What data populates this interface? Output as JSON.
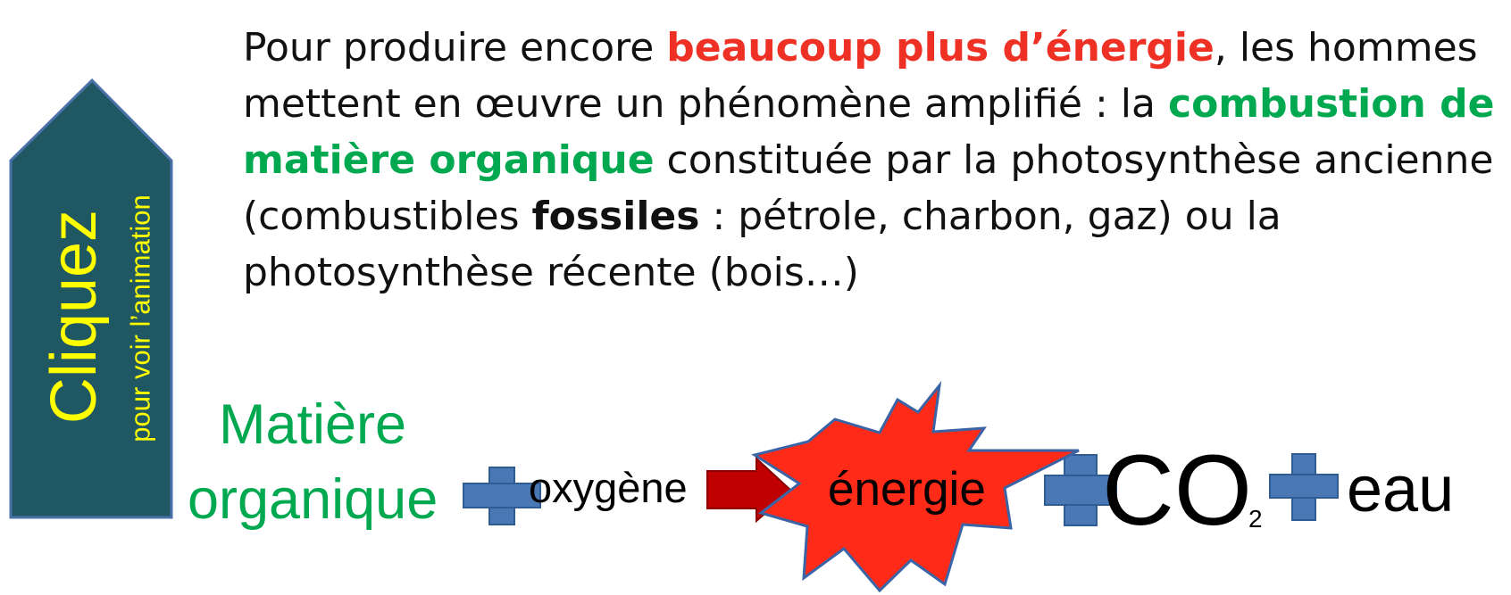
{
  "button": {
    "title": "Cliquez",
    "subtitle": "pour voir l’animation"
  },
  "intro": {
    "line1": {
      "a": "Pour produire encore ",
      "red": "beaucoup plus  d’énergie",
      "b": ", les hommes"
    },
    "line2": {
      "a": "mettent en œuvre un phénomène amplifié : la ",
      "green": "combustion de"
    },
    "line3": {
      "green": "matière organique",
      "a": " constituée par la photosynthèse ancienne"
    },
    "line4": {
      "a": "(combustibles ",
      "bold": "fossiles",
      "b": " : pétrole, charbon, gaz) ou la"
    },
    "line5": {
      "a": "photosynthèse récente (bois…)"
    }
  },
  "equation": {
    "matiere_line1": "Matière",
    "matiere_line2": "organique",
    "oxygen": "oxygène",
    "energy": "énergie",
    "co2": "CO",
    "co2_subscript": "2",
    "water": "eau"
  },
  "colors": {
    "arrow_fill": "#1f5763",
    "arrow_text": "#ffff00",
    "red_text": "#ee3124",
    "green_text": "#00a850",
    "plus_sign": "#4a78b5",
    "reaction_arrow": "#c00000",
    "burst_fill": "#ff2a17",
    "burst_stroke": "#3a64a6"
  },
  "icons": {
    "clickable_arrow": "up-arrow-shape",
    "plus": "plus-icon",
    "reaction": "right-arrow-icon",
    "energy_burst": "explosion-burst-icon"
  }
}
